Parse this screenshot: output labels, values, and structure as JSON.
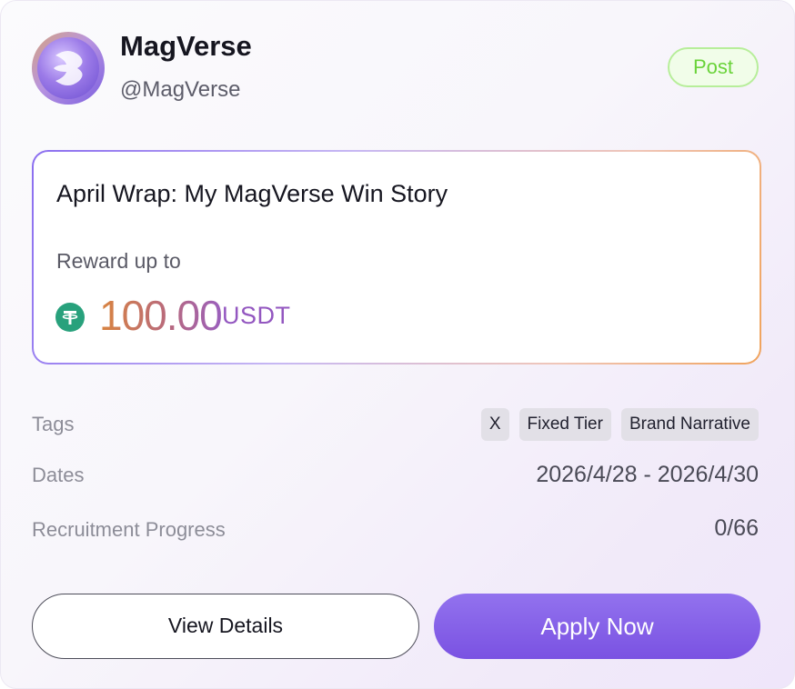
{
  "brand": {
    "name": "MagVerse",
    "handle": "@MagVerse",
    "avatar_icon": "magverse-logo"
  },
  "badge": {
    "label": "Post",
    "color": "#6ad33a"
  },
  "task": {
    "title": "April Wrap: My MagVerse Win Story",
    "reward_label": "Reward up to",
    "reward_amount": "100.00",
    "reward_unit": "USDT",
    "token_icon": "tether-icon"
  },
  "details": {
    "tags_label": "Tags",
    "tags": [
      "X",
      "Fixed Tier",
      "Brand Narrative"
    ],
    "dates_label": "Dates",
    "dates_value": "2026/4/28 - 2026/4/30",
    "progress_label": "Recruitment Progress",
    "progress_value": "0/66"
  },
  "actions": {
    "view_details": "View Details",
    "apply_now": "Apply Now"
  },
  "colors": {
    "accent": "#7a52e2",
    "tether": "#28a17c",
    "reward_gradient_start": "#d9843f",
    "reward_gradient_end": "#9a5fbd"
  }
}
